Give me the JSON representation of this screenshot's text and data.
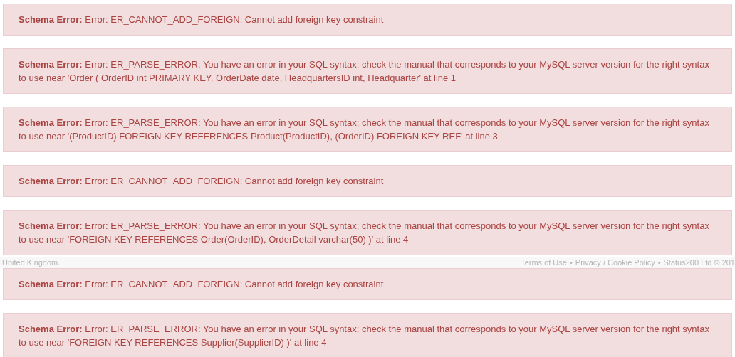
{
  "alerts_top": [
    {
      "text": "**Schema Error:** Error: ER_CANNOT_ADD_FOREIGN: Cannot add foreign key constraint"
    },
    {
      "text": "**Schema Error:** Error: ER_PARSE_ERROR: You have an error in your SQL syntax; check the manual that corresponds to your MySQL server version for the right syntax to use near 'Order ( OrderID int PRIMARY KEY, OrderDate date, HeadquartersID int, Headquarter' at line 1"
    },
    {
      "text": "**Schema Error:** Error: ER_PARSE_ERROR: You have an error in your SQL syntax; check the manual that corresponds to your MySQL server version for the right syntax to use near '(ProductID) FOREIGN KEY REFERENCES Product(ProductID), (OrderID) FOREIGN KEY REF' at line 3"
    },
    {
      "text": "**Schema Error:** Error: ER_CANNOT_ADD_FOREIGN: Cannot add foreign key constraint"
    },
    {
      "text": "**Schema Error:** Error: ER_PARSE_ERROR: You have an error in your SQL syntax; check the manual that corresponds to your MySQL server version for the right syntax to use near 'FOREIGN KEY REFERENCES Order(OrderID), OrderDetail varchar(50) )' at line 4"
    }
  ],
  "footer": {
    "location": "United Kingdom.",
    "separator": "•",
    "links": [
      "Terms of Use",
      "Privacy / Cookie Policy",
      "Status200 Ltd © 201"
    ]
  },
  "alerts_bottom": [
    {
      "text": "**Schema Error:** Error: ER_CANNOT_ADD_FOREIGN: Cannot add foreign key constraint"
    },
    {
      "text": "**Schema Error:** Error: ER_PARSE_ERROR: You have an error in your SQL syntax; check the manual that corresponds to your MySQL server version for the right syntax to use near 'FOREIGN KEY REFERENCES Supplier(SupplierID) )' at line 4"
    }
  ]
}
